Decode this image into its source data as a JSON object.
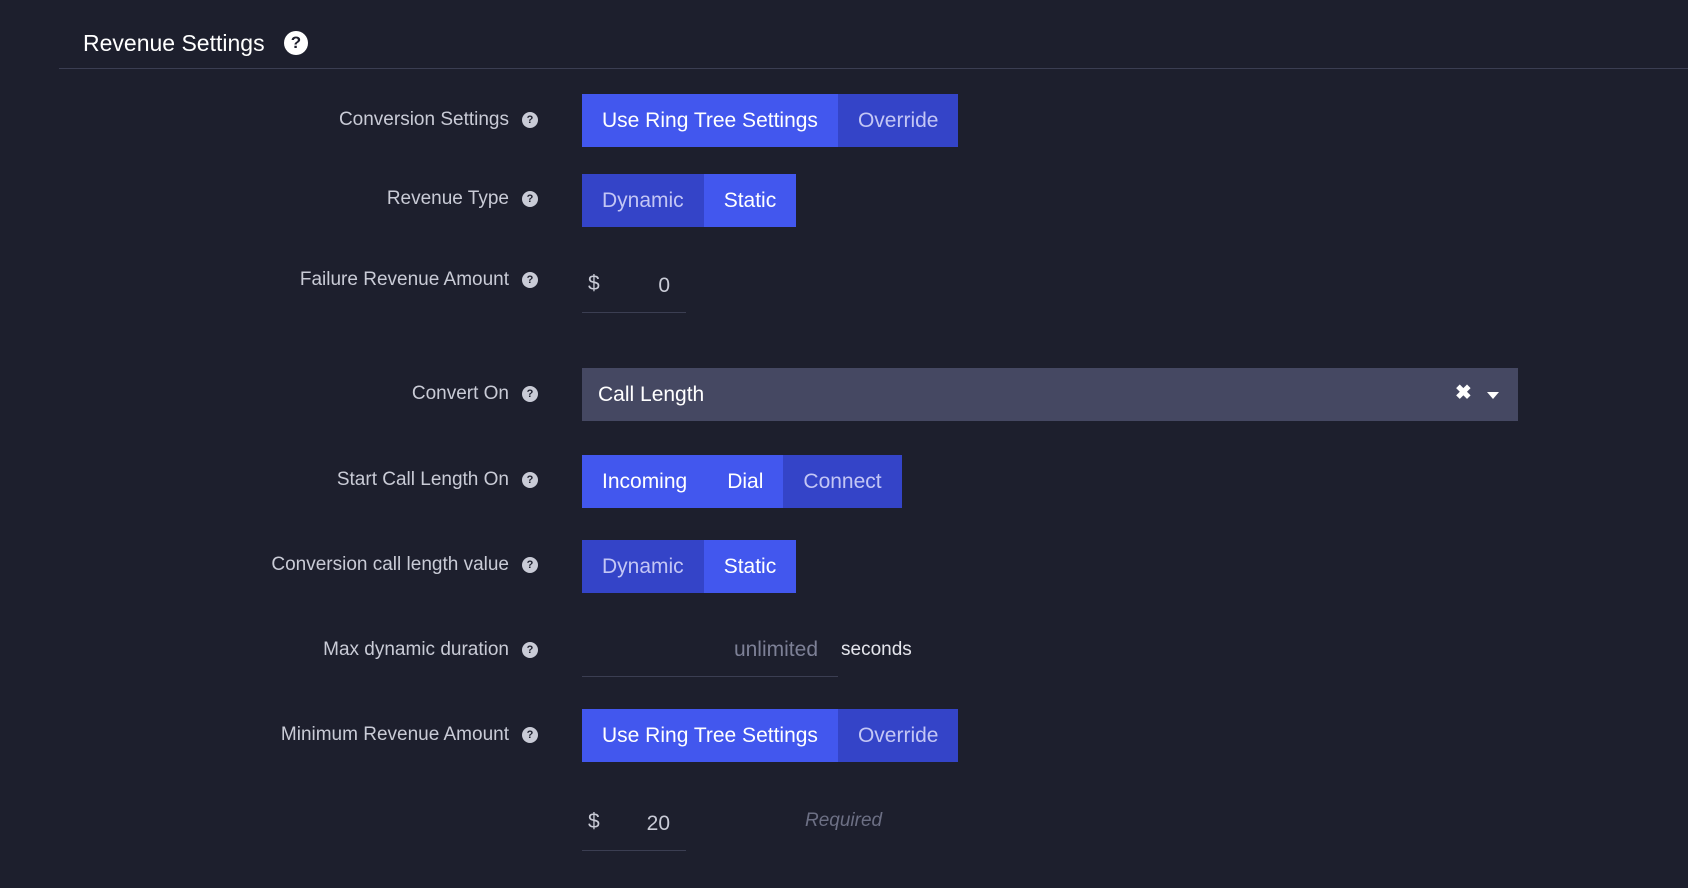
{
  "section": {
    "title": "Revenue Settings",
    "help_glyph": "?"
  },
  "rows": {
    "conversion_settings": {
      "label": "Conversion Settings",
      "options": [
        "Use Ring Tree Settings",
        "Override"
      ],
      "selected": "Use Ring Tree Settings"
    },
    "revenue_type": {
      "label": "Revenue Type",
      "options": [
        "Dynamic",
        "Static"
      ],
      "selected": "Static"
    },
    "failure_revenue_amount": {
      "label": "Failure Revenue Amount",
      "currency": "$",
      "value": "0"
    },
    "convert_on": {
      "label": "Convert On",
      "value": "Call Length",
      "clear_glyph": "✖"
    },
    "start_call_length_on": {
      "label": "Start Call Length On",
      "options": [
        "Incoming",
        "Dial",
        "Connect"
      ],
      "selected": [
        "Incoming",
        "Dial"
      ]
    },
    "conversion_call_length_value": {
      "label": "Conversion call length value",
      "options": [
        "Dynamic",
        "Static"
      ],
      "selected": "Static"
    },
    "max_dynamic_duration": {
      "label": "Max dynamic duration",
      "placeholder": "unlimited",
      "suffix": "seconds"
    },
    "minimum_revenue_amount": {
      "label": "Minimum Revenue Amount",
      "options": [
        "Use Ring Tree Settings",
        "Override"
      ],
      "selected": "Use Ring Tree Settings",
      "currency": "$",
      "value": "20",
      "required_text": "Required"
    }
  },
  "icons": {
    "help": "question-circle-icon",
    "clear": "close-icon",
    "dropdown": "caret-down-icon"
  },
  "colors": {
    "background": "#1d1f2d",
    "accent_active": "#4257ee",
    "accent_inactive": "#3444c8",
    "select_bg": "#454862"
  }
}
